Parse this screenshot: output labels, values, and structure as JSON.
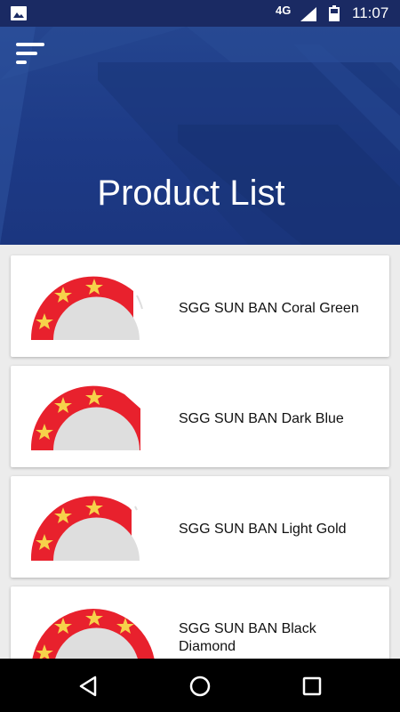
{
  "status_bar": {
    "network": "4G",
    "time": "11:07"
  },
  "header": {
    "title": "Product List"
  },
  "products": [
    {
      "name": "SGG SUN BAN Coral Green"
    },
    {
      "name": "SGG SUN BAN Dark Blue"
    },
    {
      "name": "SGG SUN BAN Light Gold"
    },
    {
      "name": "SGG SUN BAN Black Diamond"
    }
  ],
  "colors": {
    "header": "#1d3a86",
    "status_bar": "#1a2a63",
    "badge_red": "#e8212d",
    "star": "#f6d24a",
    "dome": "#dedede"
  },
  "icons": [
    "gallery-icon",
    "signal-icon",
    "battery-icon",
    "menu-icon",
    "back-icon",
    "home-icon",
    "recents-icon"
  ]
}
